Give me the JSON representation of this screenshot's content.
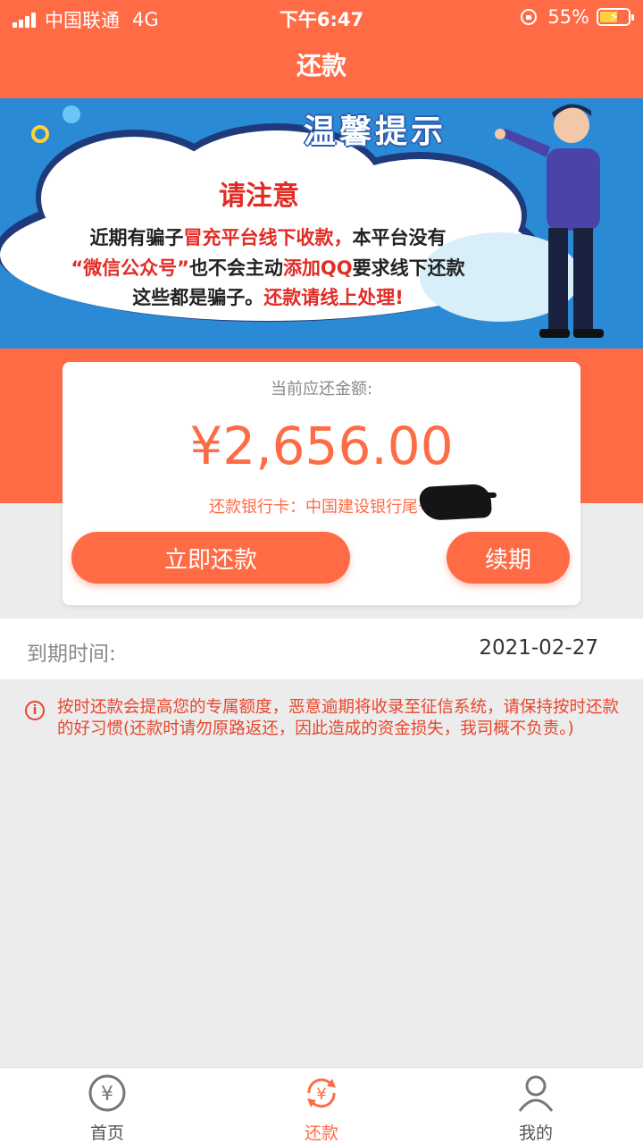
{
  "status_bar": {
    "carrier": "中国联通",
    "network": "4G",
    "time": "下午6:47",
    "battery": "55%"
  },
  "nav": {
    "title": "还款"
  },
  "banner": {
    "heading": "温馨提示",
    "attention": "请注意",
    "line1": {
      "a": "近期有骗子",
      "b": "冒充平台线下收款，",
      "c": "本平台没有"
    },
    "line2": {
      "a": "“微信公众号”",
      "b": "也不会主动",
      "c": "添加QQ",
      "d": "要求线下还款"
    },
    "line3": {
      "a": "这些都是骗子。",
      "b": "还款请线上处理!"
    }
  },
  "card": {
    "amount_label": "当前应还金额:",
    "amount": "¥2,656.00",
    "bank_label": "还款银行卡：中国建设银行尾号",
    "pay_button": "立即还款",
    "renew_button": "续期"
  },
  "due": {
    "label": "到期时间:",
    "date": "2021-02-27"
  },
  "notice": {
    "text": "按时还款会提高您的专属额度，恶意逾期将收录至征信系统，请保持按时还款的好习惯(还款时请勿原路返还，因此造成的资金损失，我司概不负责。)"
  },
  "tabs": [
    {
      "label": "首页",
      "icon": "yen-circle-icon",
      "active": false
    },
    {
      "label": "还款",
      "icon": "repay-cycle-icon",
      "active": true
    },
    {
      "label": "我的",
      "icon": "user-icon",
      "active": false
    }
  ],
  "colors": {
    "accent": "#ff6b45",
    "banner_blue": "#2a8ad6",
    "notice_red": "#e8462b"
  }
}
